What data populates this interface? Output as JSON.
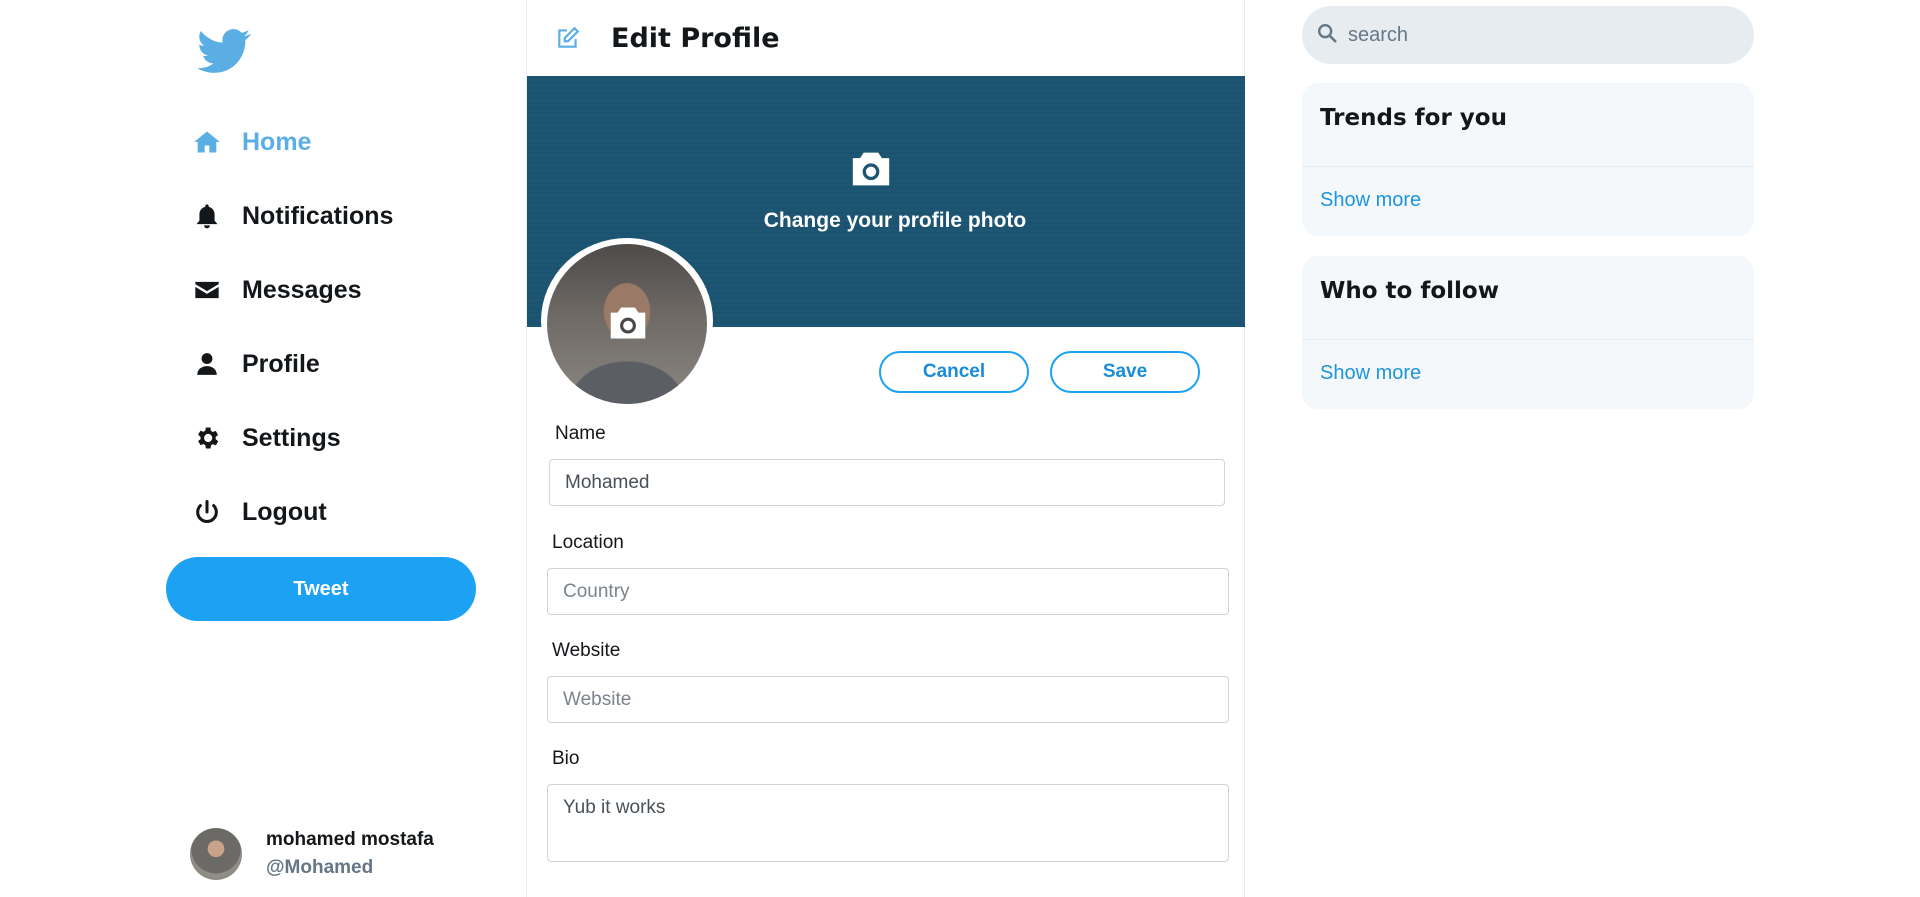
{
  "sidebar": {
    "logo_icon": "twitter-bird-icon",
    "items": [
      {
        "label": "Home",
        "icon": "home-icon",
        "active": true
      },
      {
        "label": "Notifications",
        "icon": "bell-icon"
      },
      {
        "label": "Messages",
        "icon": "envelope-icon"
      },
      {
        "label": "Profile",
        "icon": "user-icon"
      },
      {
        "label": "Settings",
        "icon": "gear-icon"
      },
      {
        "label": "Logout",
        "icon": "power-icon"
      }
    ],
    "tweet_label": "Tweet",
    "account": {
      "name": "mohamed mostafa",
      "handle": "@Mohamed"
    }
  },
  "main": {
    "title": "Edit Profile",
    "banner_text": "Change your profile photo",
    "cancel_label": "Cancel",
    "save_label": "Save",
    "fields": {
      "name": {
        "label": "Name",
        "value": "Mohamed",
        "placeholder": ""
      },
      "location": {
        "label": "Location",
        "value": "",
        "placeholder": "Country"
      },
      "website": {
        "label": "Website",
        "value": "",
        "placeholder": "Website"
      },
      "bio": {
        "label": "Bio",
        "value": "Yub it works"
      }
    }
  },
  "right": {
    "search_placeholder": "search",
    "trends_title": "Trends for you",
    "follow_title": "Who to follow",
    "show_more": "Show more"
  },
  "colors": {
    "accent": "#1da1f2",
    "active_nav": "#5aaee4",
    "banner": "#1d5673",
    "link": "#1b95e0"
  }
}
